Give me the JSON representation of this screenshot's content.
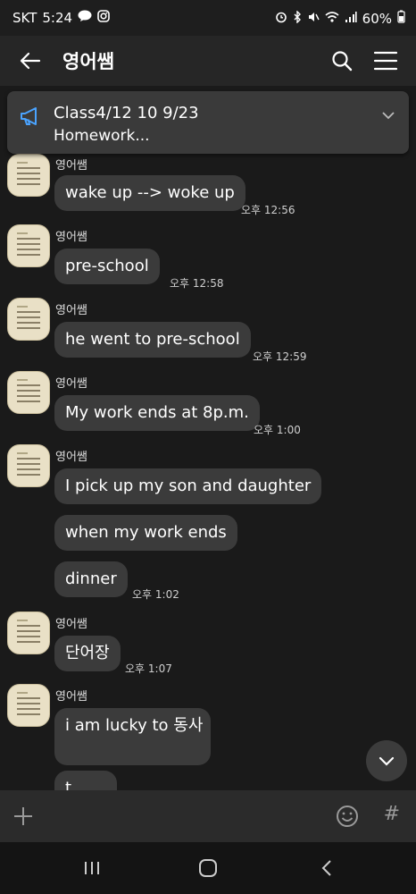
{
  "status_bar": {
    "carrier": "SKT",
    "time": "5:24",
    "battery": "60%",
    "left_icons": [
      "talk-icon",
      "instagram-icon"
    ],
    "right_icons": [
      "alarm-icon",
      "bluetooth-icon",
      "mute-icon",
      "wifi-icon",
      "signal-icon"
    ]
  },
  "app_bar": {
    "title": "영어쌤"
  },
  "notice": {
    "title": "Class4/12 10 9/23",
    "body": "Homework..."
  },
  "messages": [
    {
      "sender": "영어쌤",
      "bubbles": [
        "wake up --> woke up"
      ],
      "time": "오후 12:56"
    },
    {
      "sender": "영어쌤",
      "bubbles": [
        "pre-school"
      ],
      "time": "오후 12:58"
    },
    {
      "sender": "영어쌤",
      "bubbles": [
        "he went to pre-school"
      ],
      "time": "오후 12:59"
    },
    {
      "sender": "영어쌤",
      "bubbles": [
        "My work ends at 8p.m."
      ],
      "time": "오후 1:00"
    },
    {
      "sender": "영어쌤",
      "bubbles": [
        "I pick up my son and daughter",
        "when my work ends",
        "dinner"
      ],
      "time": "오후 1:02"
    },
    {
      "sender": "영어쌤",
      "bubbles": [
        "단어장"
      ],
      "time": "오후 1:07"
    },
    {
      "sender": "영어쌤",
      "bubbles": [
        "i am lucky to 동사",
        "t..."
      ],
      "time": ""
    }
  ],
  "colors": {
    "background": "#1a1a1a",
    "bubble": "#3b3b3b",
    "notice_icon": "#4aa3ff"
  }
}
